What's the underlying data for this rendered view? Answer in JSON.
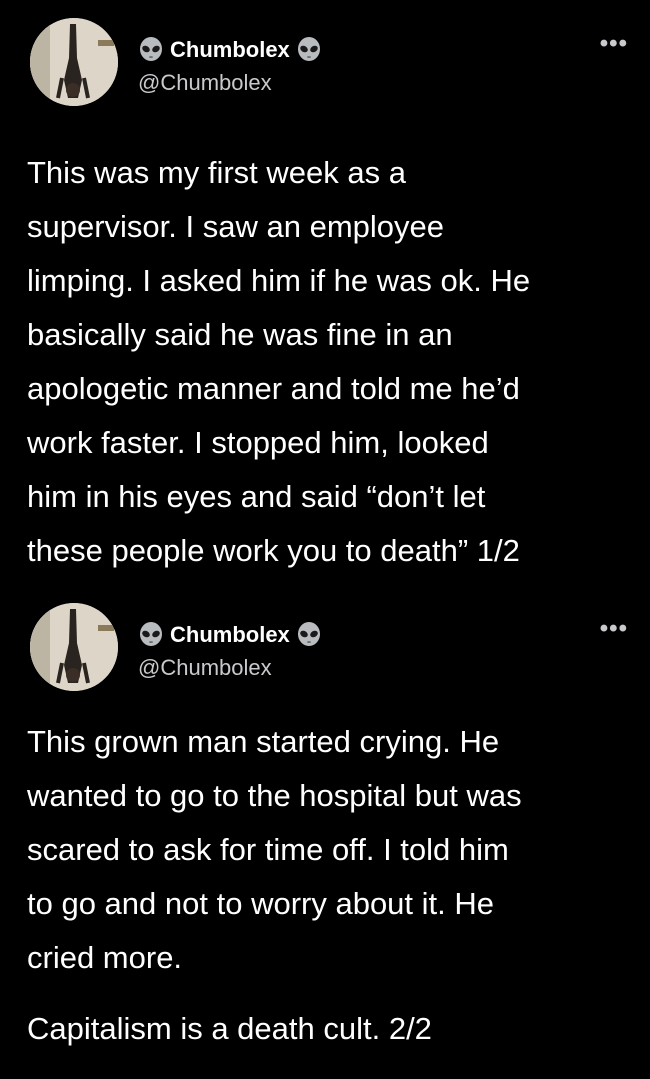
{
  "colors": {
    "background": "#000000",
    "text": "#ffffff",
    "secondary_text": "#c7c9cc"
  },
  "tweets": [
    {
      "avatar_icon": "profile-photo-handstand",
      "name_emoji_icon": "alien-emoji",
      "display_name": "Chumbolex",
      "handle": "@Chumbolex",
      "more_label": "•••",
      "lines": [
        "This was my first week as a",
        "supervisor. I saw an employee",
        "limping. I asked him if he was ok. He",
        "basically said he was fine in an",
        "apologetic manner and told me he’d",
        "work faster. I stopped him, looked",
        "him in his eyes and said “don’t let",
        "these people work you to death” 1/2"
      ]
    },
    {
      "avatar_icon": "profile-photo-handstand",
      "name_emoji_icon": "alien-emoji",
      "display_name": "Chumbolex",
      "handle": "@Chumbolex",
      "more_label": "•••",
      "lines": [
        "This grown man started crying. He",
        "wanted to go to the hospital but was",
        "scared to ask for time off. I told him",
        "to go and not to worry about it. He",
        "cried more."
      ],
      "closing": "Capitalism is a death cult. 2/2"
    }
  ]
}
